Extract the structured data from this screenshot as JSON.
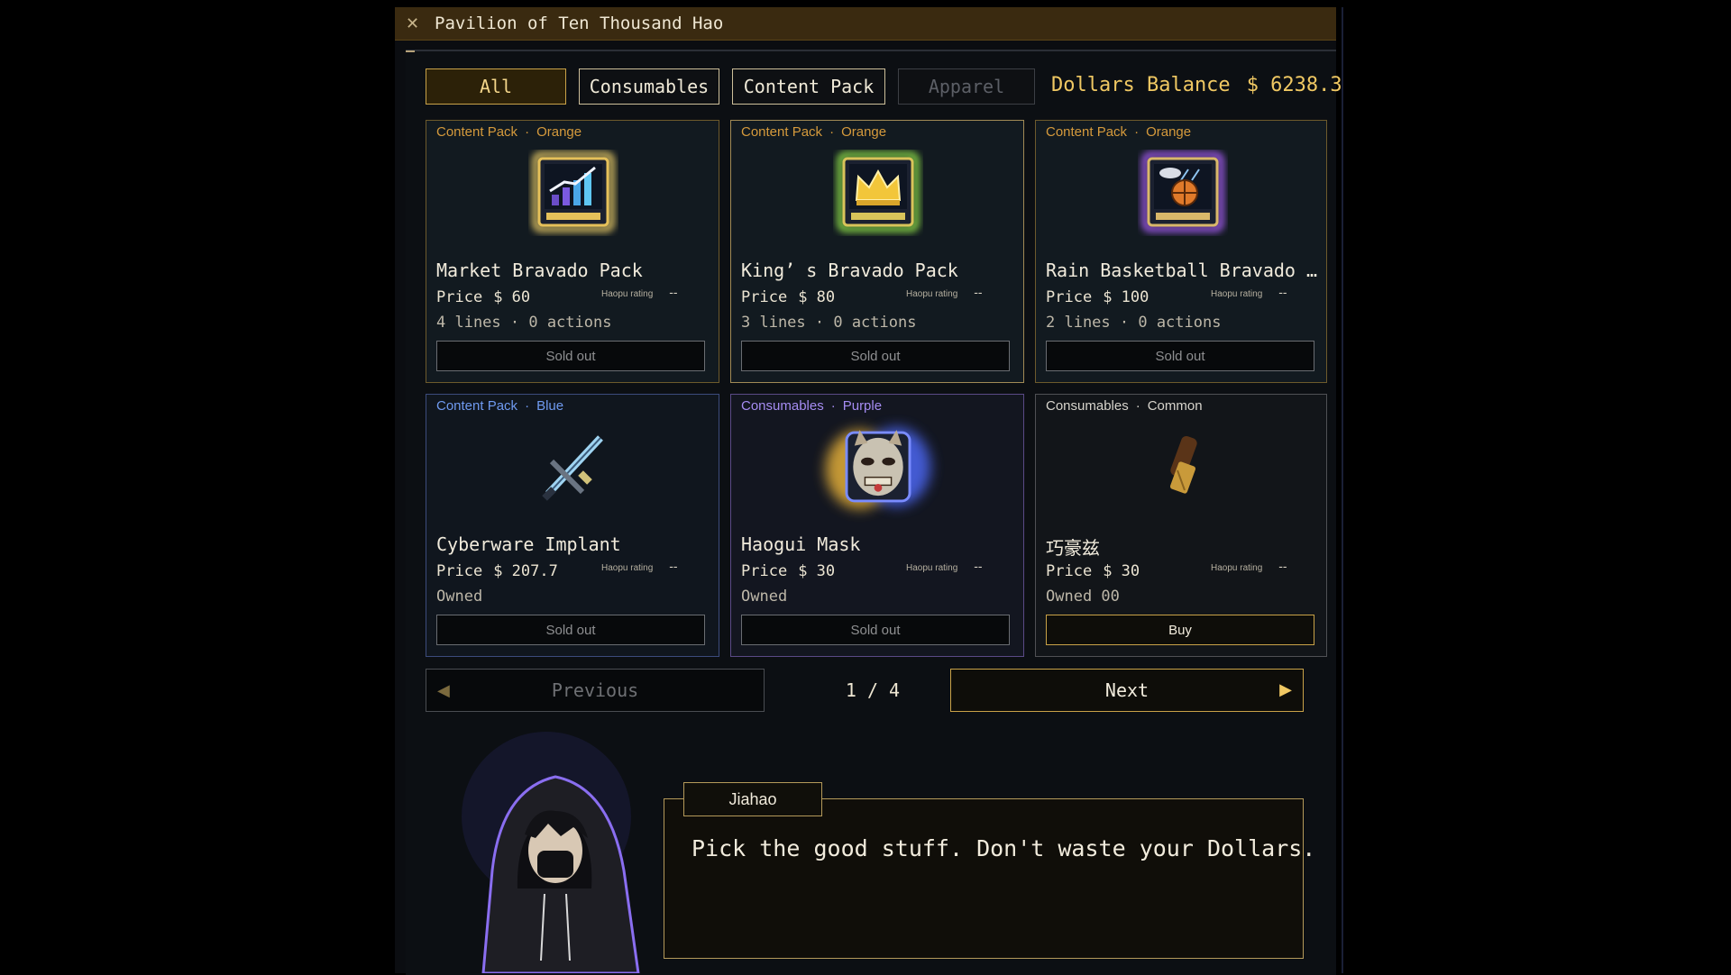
{
  "window": {
    "title": "Pavilion of Ten Thousand Hao",
    "close_icon": "close-icon"
  },
  "tabs": [
    {
      "label": "All",
      "state": "active"
    },
    {
      "label": "Consumables",
      "state": "normal"
    },
    {
      "label": "Content Pack",
      "state": "normal"
    },
    {
      "label": "Apparel",
      "state": "disabled"
    }
  ],
  "balance": {
    "label": "Dollars Balance",
    "amount": "$ 6238.3"
  },
  "items": [
    {
      "category": "Content Pack",
      "rarity": "Orange",
      "icon": "rising-chart-card-icon",
      "name": "Market Bravado Pack",
      "price_label": "Price",
      "price": "$ 60",
      "rating_label": "Haopu rating",
      "rating": "--",
      "meta": "4 lines  ·  0 actions",
      "button": "Sold out"
    },
    {
      "category": "Content Pack",
      "rarity": "Orange",
      "icon": "crown-card-icon",
      "name": "King’ s Bravado Pack",
      "price_label": "Price",
      "price": "$ 80",
      "rating_label": "Haopu rating",
      "rating": "--",
      "meta": "3 lines  ·  0 actions",
      "button": "Sold out"
    },
    {
      "category": "Content Pack",
      "rarity": "Orange",
      "icon": "basketball-rain-card-icon",
      "name": "Rain Basketball Bravado P…",
      "price_label": "Price",
      "price": "$ 100",
      "rating_label": "Haopu rating",
      "rating": "--",
      "meta": "2 lines  ·  0 actions",
      "button": "Sold out"
    },
    {
      "category": "Content Pack",
      "rarity": "Blue",
      "icon": "cyber-blade-icon",
      "name": "Cyberware Implant",
      "price_label": "Price",
      "price": "$ 207.7",
      "rating_label": "Haopu rating",
      "rating": "--",
      "meta": "Owned",
      "button": "Sold out"
    },
    {
      "category": "Consumables",
      "rarity": "Purple",
      "icon": "demon-mask-icon",
      "name": "Haogui Mask",
      "price_label": "Price",
      "price": "$ 30",
      "rating_label": "Haopu rating",
      "rating": "--",
      "meta": "Owned",
      "button": "Sold out"
    },
    {
      "category": "Consumables",
      "rarity": "Common",
      "icon": "chocolate-bar-icon",
      "name": "巧豪兹",
      "price_label": "Price",
      "price": "$ 30",
      "rating_label": "Haopu rating",
      "rating": "--",
      "meta": "Owned  00",
      "button": "Buy"
    }
  ],
  "pagination": {
    "previous": "Previous",
    "page": "1 / 4",
    "next": "Next"
  },
  "dialogue": {
    "speaker": "Jiahao",
    "text": "Pick the good stuff. Don't waste your Dollars."
  },
  "colors": {
    "accent_gold": "#c9a248",
    "balance_gold": "#f0c863",
    "orange_rarity": "#d59a3c",
    "blue_rarity": "#6f9af0",
    "purple_rarity": "#a58cf2"
  }
}
